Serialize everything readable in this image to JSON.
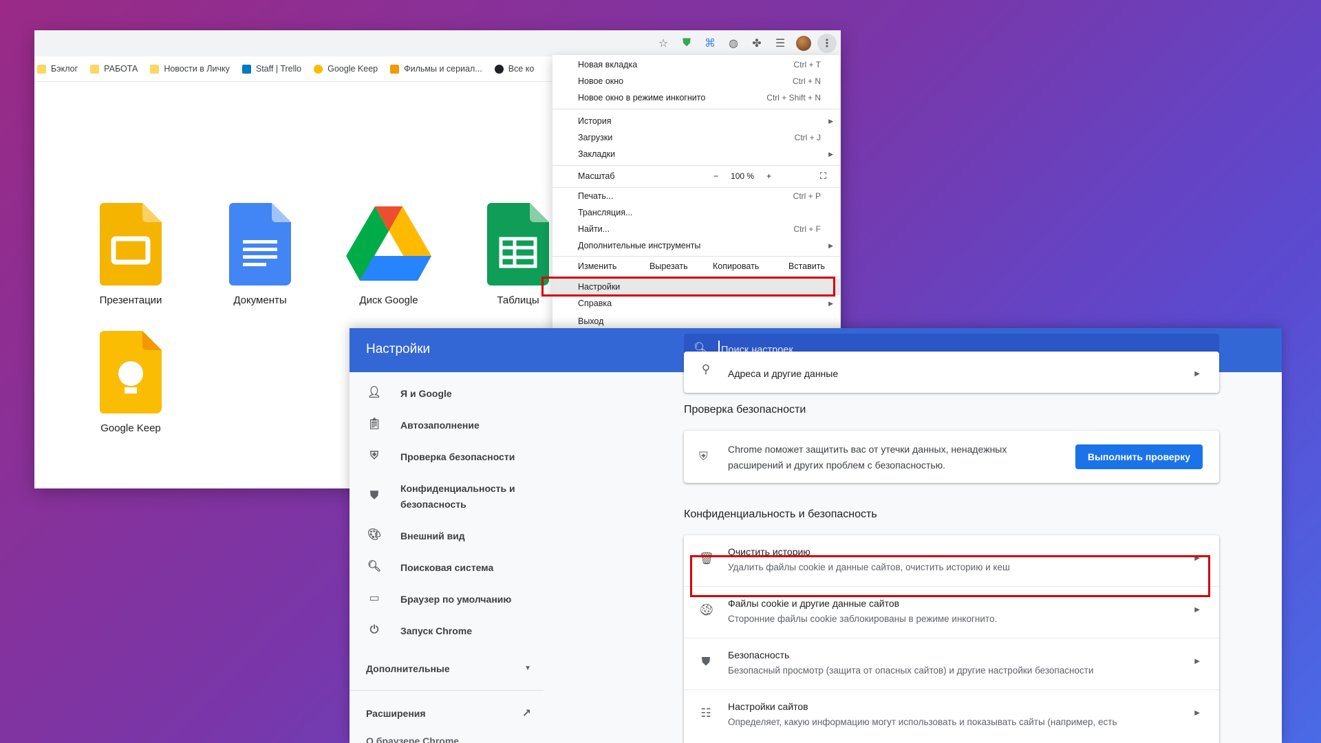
{
  "colors": {
    "settings_header": "#3367d6",
    "search_box": "#2a56c6",
    "primary_button": "#1a73e8",
    "highlight_border": "#d50000"
  },
  "browser": {
    "toolbar_icons": [
      "star-icon",
      "shield-extension-icon",
      "translate-icon",
      "globe-icon",
      "puzzle-icon",
      "reading-list-icon",
      "profile-avatar",
      "kebab-menu-icon"
    ],
    "bookmarks": [
      {
        "label": "Бэклог",
        "icon": "folder-icon"
      },
      {
        "label": "РАБОТА",
        "icon": "folder-icon"
      },
      {
        "label": "Новости в Личку",
        "icon": "folder-icon"
      },
      {
        "label": "Staff | Trello",
        "icon": "trello-icon"
      },
      {
        "label": "Google Keep",
        "icon": "keep-icon"
      },
      {
        "label": "Фильмы и сериал...",
        "icon": "hd-icon"
      },
      {
        "label": "Все ко",
        "icon": "alien-icon"
      }
    ],
    "apps": [
      {
        "label": "Презентации",
        "icon": "slides-icon"
      },
      {
        "label": "Документы",
        "icon": "docs-icon"
      },
      {
        "label": "Диск Google",
        "icon": "drive-icon"
      },
      {
        "label": "Таблицы",
        "icon": "sheets-icon"
      },
      {
        "label": "Google Keep",
        "icon": "keep-icon"
      }
    ]
  },
  "menu": {
    "new_tab": {
      "label": "Новая вкладка",
      "shortcut": "Ctrl + T"
    },
    "new_window": {
      "label": "Новое окно",
      "shortcut": "Ctrl + N"
    },
    "incognito": {
      "label": "Новое окно в режиме инкогнито",
      "shortcut": "Ctrl + Shift + N"
    },
    "history": {
      "label": "История"
    },
    "downloads": {
      "label": "Загрузки",
      "shortcut": "Ctrl + J"
    },
    "bookmarks": {
      "label": "Закладки"
    },
    "zoom": {
      "label": "Масштаб",
      "minus": "−",
      "value": "100 %",
      "plus": "+"
    },
    "print": {
      "label": "Печать...",
      "shortcut": "Ctrl + P"
    },
    "cast": {
      "label": "Трансляция..."
    },
    "find": {
      "label": "Найти...",
      "shortcut": "Ctrl + F"
    },
    "more_tools": {
      "label": "Дополнительные инструменты"
    },
    "edit": {
      "label": "Изменить",
      "cut": "Вырезать",
      "copy": "Копировать",
      "paste": "Вставить"
    },
    "settings": {
      "label": "Настройки"
    },
    "help": {
      "label": "Справка"
    },
    "exit": {
      "label": "Выход"
    }
  },
  "settings": {
    "title": "Настройки",
    "search_placeholder": "Поиск настроек",
    "nav": [
      {
        "label": "Я и Google",
        "icon": "person-icon"
      },
      {
        "label": "Автозаполнение",
        "icon": "clipboard-icon"
      },
      {
        "label": "Проверка безопасности",
        "icon": "shield-check-icon"
      },
      {
        "label": "Конфиденциальность и безопасность",
        "icon": "shield-icon"
      },
      {
        "label": "Внешний вид",
        "icon": "palette-icon"
      },
      {
        "label": "Поисковая система",
        "icon": "search-icon"
      },
      {
        "label": "Браузер по умолчанию",
        "icon": "browser-icon"
      },
      {
        "label": "Запуск Chrome",
        "icon": "power-icon"
      }
    ],
    "advanced_label": "Дополнительные",
    "extensions_label": "Расширения",
    "about_label": "О браузере Chrome",
    "addresses_row": "Адреса и другие данные",
    "safety_check": {
      "section_title": "Проверка безопасности",
      "text_line1": "Chrome поможет защитить вас от утечки данных, ненадежных",
      "text_line2": "расширений и других проблем с безопасностью.",
      "button_label": "Выполнить проверку"
    },
    "privacy": {
      "section_title": "Конфиденциальность и безопасность",
      "rows": [
        {
          "title": "Очистить историю",
          "subtitle": "Удалить файлы cookie и данные сайтов, очистить историю и кеш",
          "icon": "trash-icon"
        },
        {
          "title": "Файлы cookie и другие данные сайтов",
          "subtitle": "Сторонние файлы cookie заблокированы в режиме инкогнито.",
          "icon": "cookie-icon"
        },
        {
          "title": "Безопасность",
          "subtitle": "Безопасный просмотр (защита от опасных сайтов) и другие настройки безопасности",
          "icon": "shield-icon"
        },
        {
          "title": "Настройки сайтов",
          "subtitle": "Определяет, какую информацию могут использовать и показывать сайты (например, есть",
          "icon": "sliders-icon"
        }
      ]
    }
  }
}
